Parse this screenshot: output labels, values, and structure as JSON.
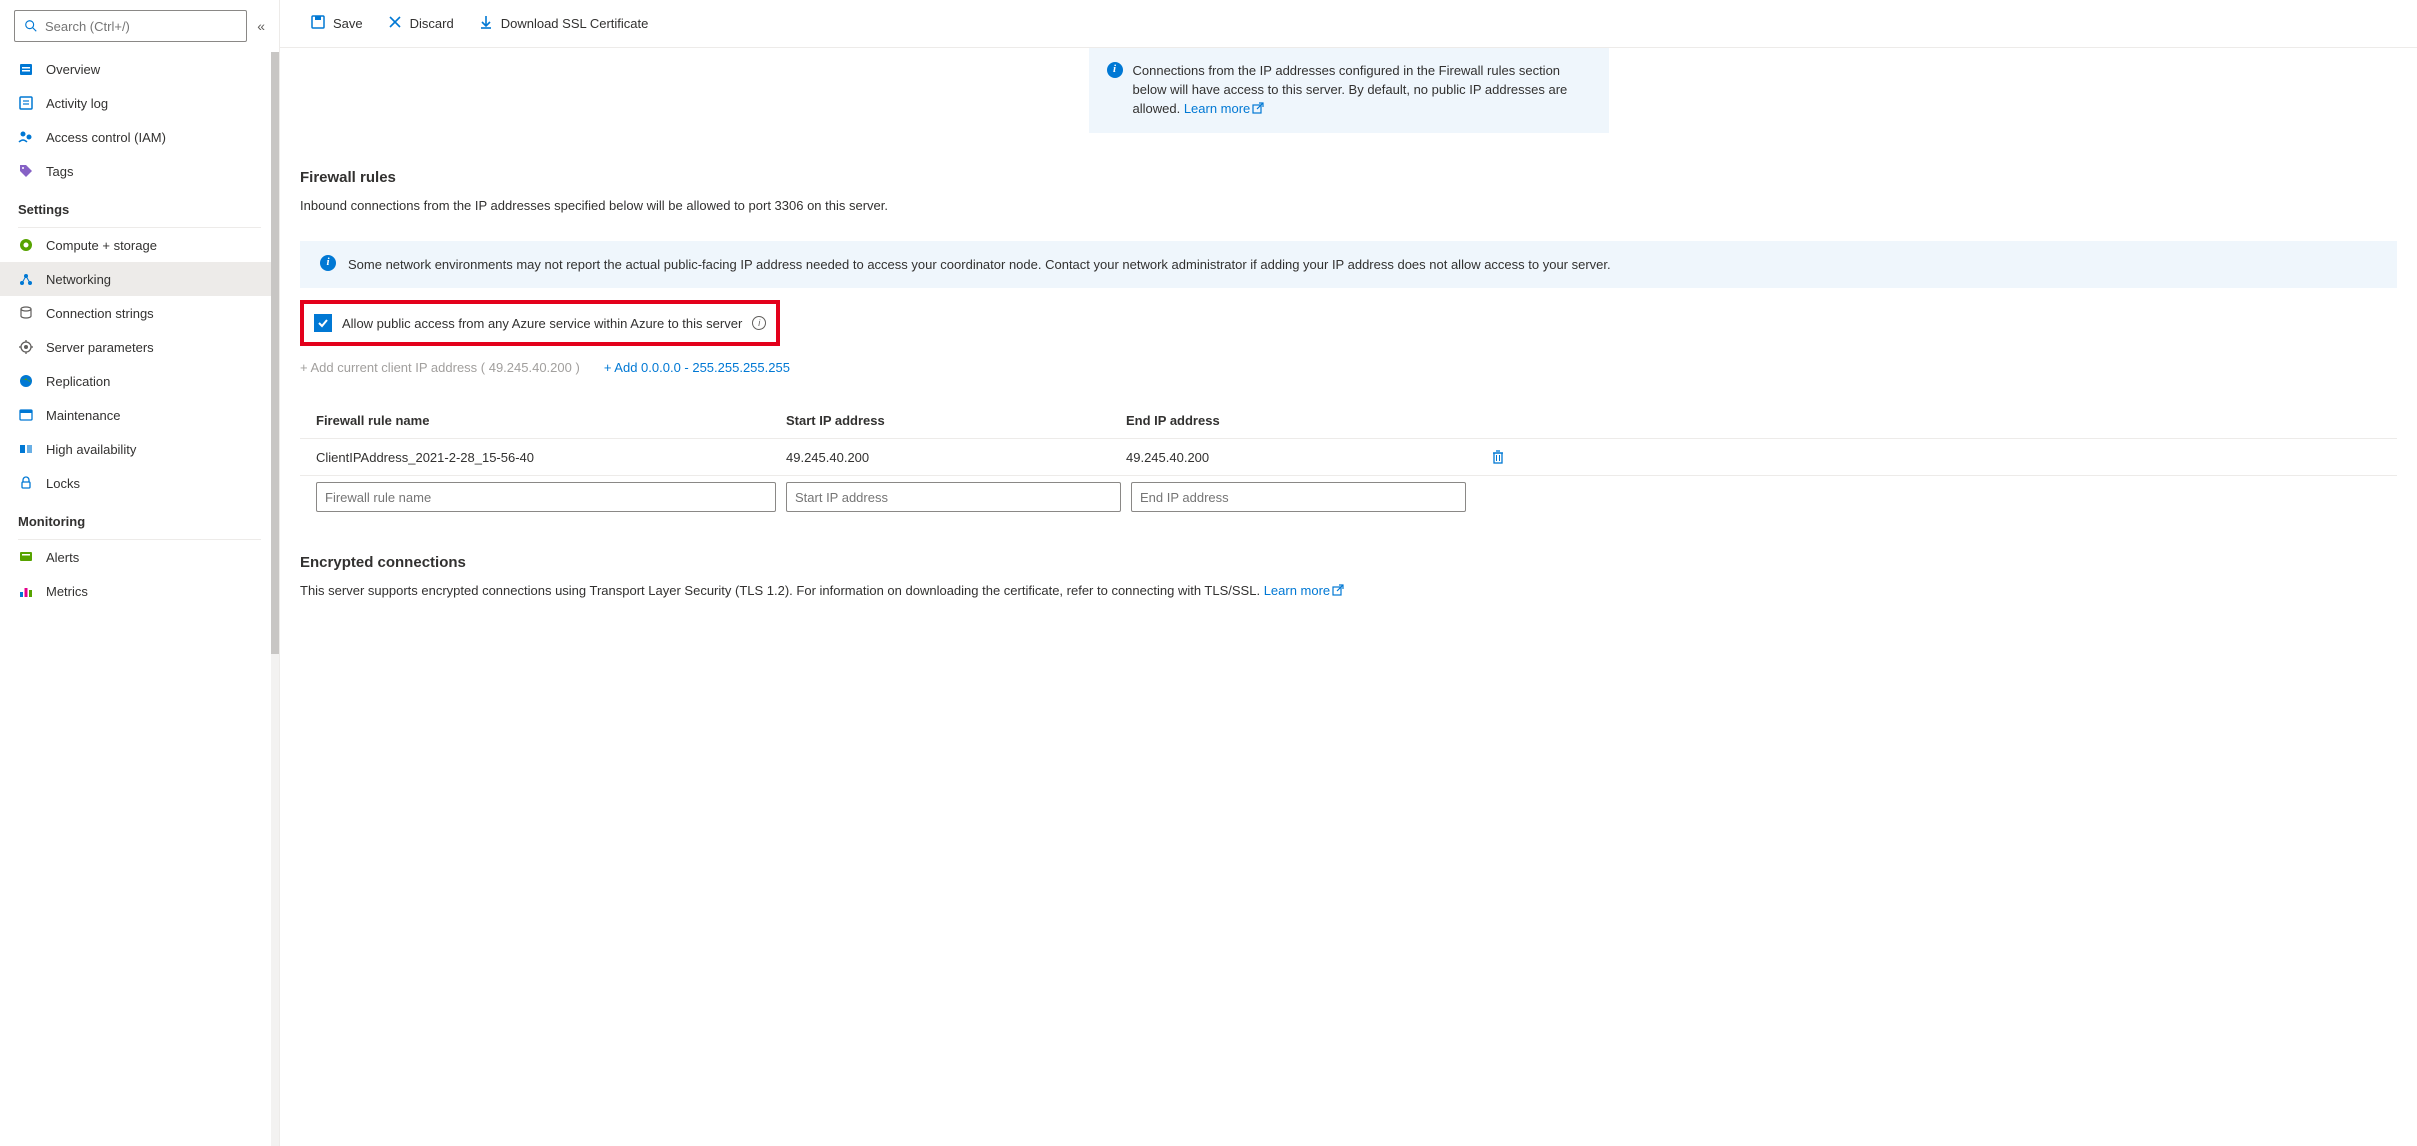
{
  "search": {
    "placeholder": "Search (Ctrl+/)"
  },
  "sidebar": {
    "top": [
      {
        "label": "Overview",
        "icon": "overview"
      },
      {
        "label": "Activity log",
        "icon": "activity"
      },
      {
        "label": "Access control (IAM)",
        "icon": "access"
      },
      {
        "label": "Tags",
        "icon": "tags"
      }
    ],
    "sections": [
      {
        "header": "Settings",
        "items": [
          {
            "label": "Compute + storage",
            "icon": "compute"
          },
          {
            "label": "Networking",
            "icon": "networking",
            "active": true
          },
          {
            "label": "Connection strings",
            "icon": "connection"
          },
          {
            "label": "Server parameters",
            "icon": "gear"
          },
          {
            "label": "Replication",
            "icon": "globe"
          },
          {
            "label": "Maintenance",
            "icon": "maintenance"
          },
          {
            "label": "High availability",
            "icon": "ha"
          },
          {
            "label": "Locks",
            "icon": "lock"
          }
        ]
      },
      {
        "header": "Monitoring",
        "items": [
          {
            "label": "Alerts",
            "icon": "alerts"
          },
          {
            "label": "Metrics",
            "icon": "metrics"
          }
        ]
      }
    ]
  },
  "toolbar": {
    "save": "Save",
    "discard": "Discard",
    "download": "Download SSL Certificate"
  },
  "banner1": {
    "text": "Connections from the IP addresses configured in the Firewall rules section below will have access to this server. By default, no public IP addresses are allowed. ",
    "link": "Learn more"
  },
  "firewall": {
    "title": "Firewall rules",
    "desc": "Inbound connections from the IP addresses specified below will be allowed to port 3306 on this server."
  },
  "banner2": {
    "text": "Some network environments may not report the actual public-facing IP address needed to access your coordinator node. Contact your network administrator if adding your IP address does not allow access to your server."
  },
  "allowAzure": {
    "label": "Allow public access from any Azure service within Azure to this server"
  },
  "ipActions": {
    "addCurrent": "+ Add current client IP address ( 49.245.40.200 )",
    "addAll": "+ Add 0.0.0.0 - 255.255.255.255"
  },
  "table": {
    "headers": {
      "name": "Firewall rule name",
      "start": "Start IP address",
      "end": "End IP address"
    },
    "rows": [
      {
        "name": "ClientIPAddress_2021-2-28_15-56-40",
        "start": "49.245.40.200",
        "end": "49.245.40.200"
      }
    ],
    "placeholders": {
      "name": "Firewall rule name",
      "start": "Start IP address",
      "end": "End IP address"
    }
  },
  "encrypted": {
    "title": "Encrypted connections",
    "desc": "This server supports encrypted connections using Transport Layer Security (TLS 1.2). For information on downloading the certificate, refer to connecting with TLS/SSL. ",
    "link": "Learn more"
  }
}
